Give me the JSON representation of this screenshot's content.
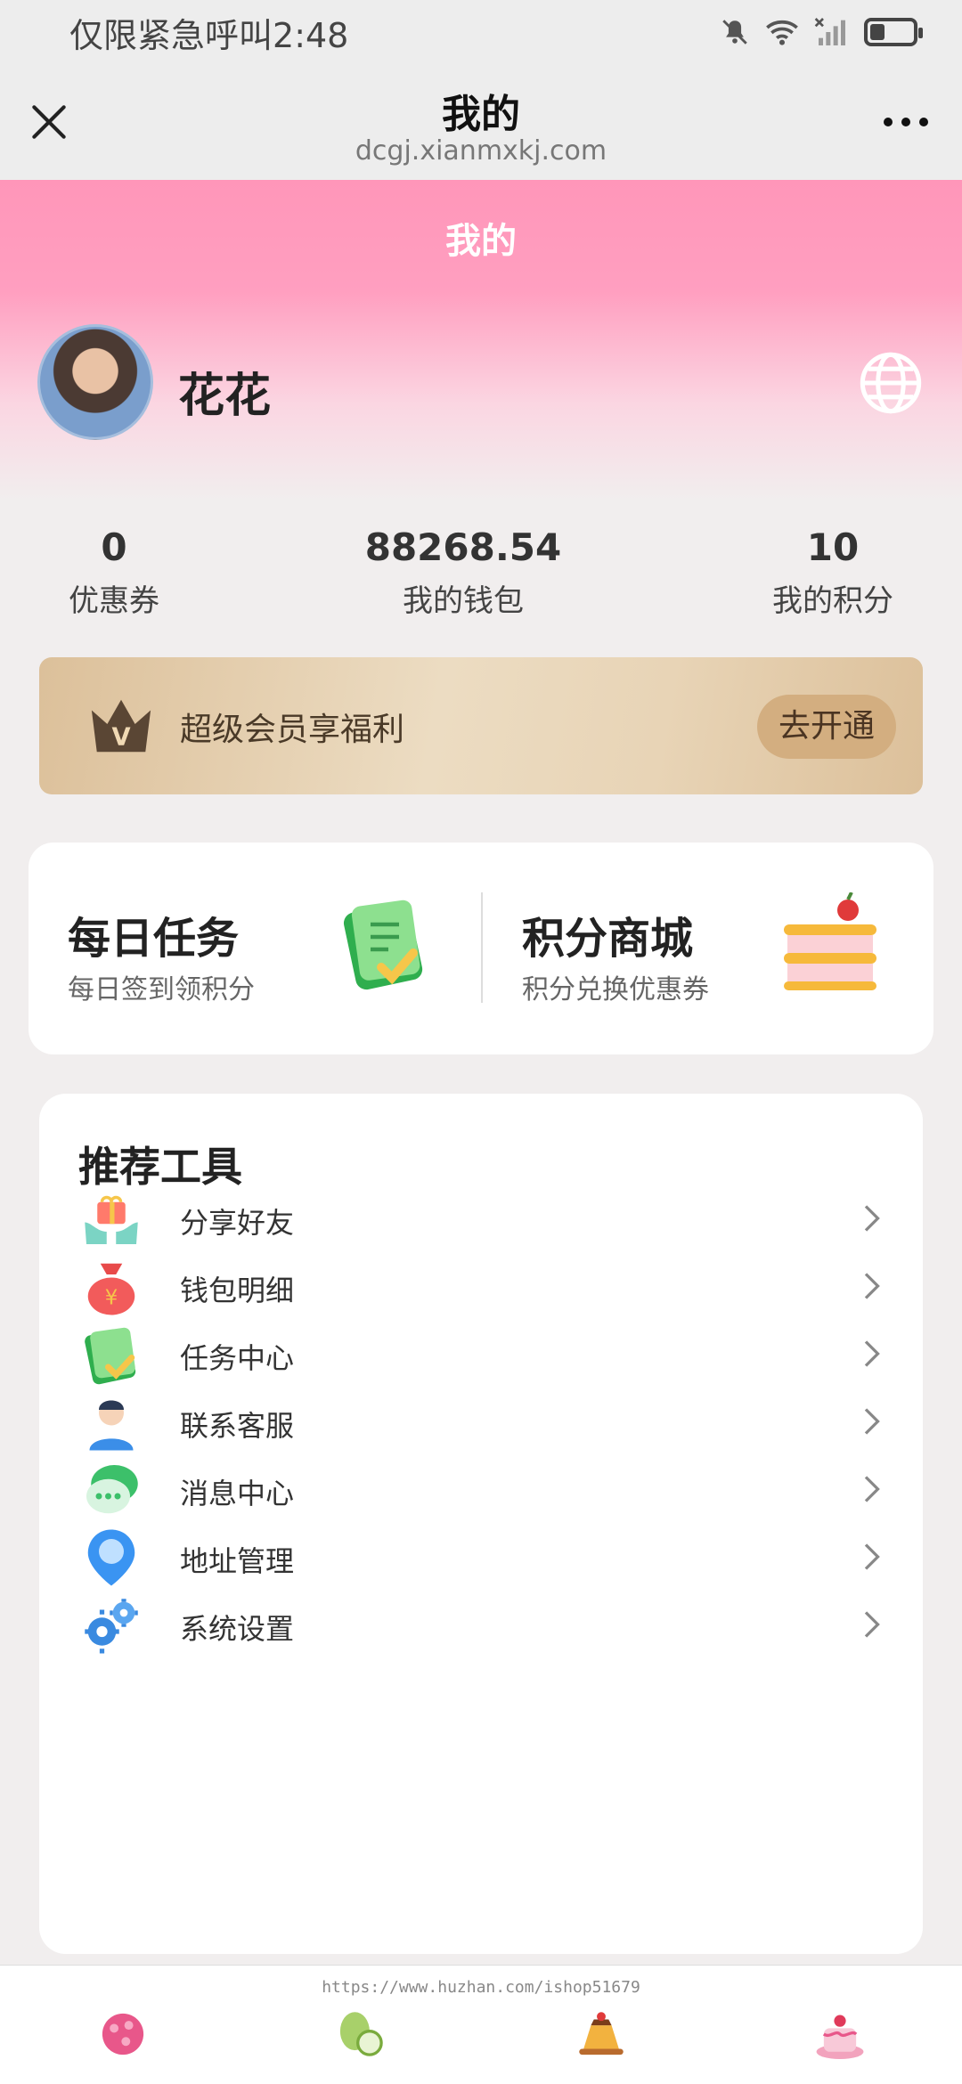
{
  "status_bar": {
    "carrier_text": "仅限紧急呼叫",
    "time": "2:48",
    "battery_level": 0.35
  },
  "nav": {
    "title": "我的",
    "url": "dcgj.xianmxkj.com"
  },
  "profile": {
    "page_title": "我的",
    "name": "花花"
  },
  "stats": [
    {
      "value": "0",
      "label": "优惠券"
    },
    {
      "value": "88268.54",
      "label": "我的钱包"
    },
    {
      "value": "10",
      "label": "我的积分"
    }
  ],
  "vip": {
    "badge_letter": "V",
    "text": "超级会员享福利",
    "button": "去开通"
  },
  "tasks": [
    {
      "title": "每日任务",
      "subtitle": "每日签到领积分",
      "icon": "checklist-icon"
    },
    {
      "title": "积分商城",
      "subtitle": "积分兑换优惠券",
      "icon": "cake-icon"
    }
  ],
  "tools": {
    "heading": "推荐工具",
    "items": [
      {
        "label": "分享好友",
        "icon": "gift-hands-icon",
        "color": "#ff7a6b"
      },
      {
        "label": "钱包明细",
        "icon": "money-bag-icon",
        "color": "#f25b5b"
      },
      {
        "label": "任务中心",
        "icon": "checklist-icon",
        "color": "#3bbd5a"
      },
      {
        "label": "联系客服",
        "icon": "support-person-icon",
        "color": "#3b8ee8"
      },
      {
        "label": "消息中心",
        "icon": "chat-bubble-icon",
        "color": "#3cc06a"
      },
      {
        "label": "地址管理",
        "icon": "location-pin-icon",
        "color": "#3a94f2"
      },
      {
        "label": "系统设置",
        "icon": "gears-icon",
        "color": "#3a8ae0"
      }
    ]
  },
  "bottom": {
    "watermark": "https://www.huzhan.com/ishop51679"
  }
}
